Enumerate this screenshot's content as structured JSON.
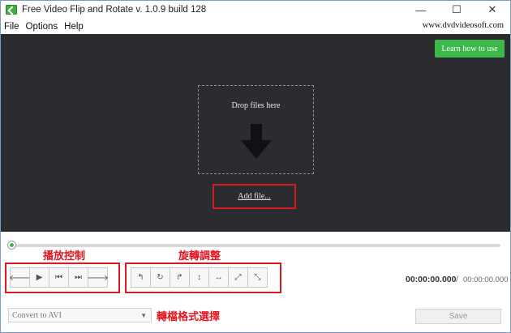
{
  "window": {
    "title": "Free Video Flip and Rotate v. 1.0.9 build 128",
    "controls": [
      {
        "name": "minimize",
        "glyph": "—"
      },
      {
        "name": "maximize",
        "glyph": "☐"
      },
      {
        "name": "close",
        "glyph": "✕"
      }
    ]
  },
  "menu": {
    "items": [
      "File",
      "Options",
      "Help"
    ],
    "site_link": "www.dvdvideosoft.com"
  },
  "main": {
    "learn_button": "Learn how to use",
    "drop_text": "Drop files here",
    "add_file": "Add file..."
  },
  "annotations": {
    "playback": "播放控制",
    "rotate": "旋轉調整",
    "format": "轉檔格式選擇"
  },
  "playback_buttons": [
    {
      "icon": "arrow-left-icon",
      "glyph": "🡐"
    },
    {
      "icon": "play-icon",
      "glyph": "▶"
    },
    {
      "icon": "skip-start-icon",
      "glyph": "⏮"
    },
    {
      "icon": "skip-end-icon",
      "glyph": "⏭"
    },
    {
      "icon": "arrow-right-icon",
      "glyph": "🡒"
    }
  ],
  "rotate_buttons": [
    {
      "icon": "rotate-left-icon",
      "glyph": "↰"
    },
    {
      "icon": "rotate-180-icon",
      "glyph": "↻"
    },
    {
      "icon": "rotate-right-icon",
      "glyph": "↱"
    },
    {
      "icon": "flip-vertical-icon",
      "glyph": "↕"
    },
    {
      "icon": "flip-horizontal-icon",
      "glyph": "↔"
    },
    {
      "icon": "transpose-icon",
      "glyph": "⤢"
    },
    {
      "icon": "transverse-icon",
      "glyph": "⤡"
    }
  ],
  "time": {
    "current": "00:00:00.000",
    "separator": "/",
    "total": "00:00:00.000"
  },
  "footer": {
    "convert_value": "Convert to AVI",
    "save_label": "Save"
  },
  "colors": {
    "main_bg": "#2b2c30",
    "accent_green": "#3cb84a",
    "annotation_red": "#d71921"
  }
}
